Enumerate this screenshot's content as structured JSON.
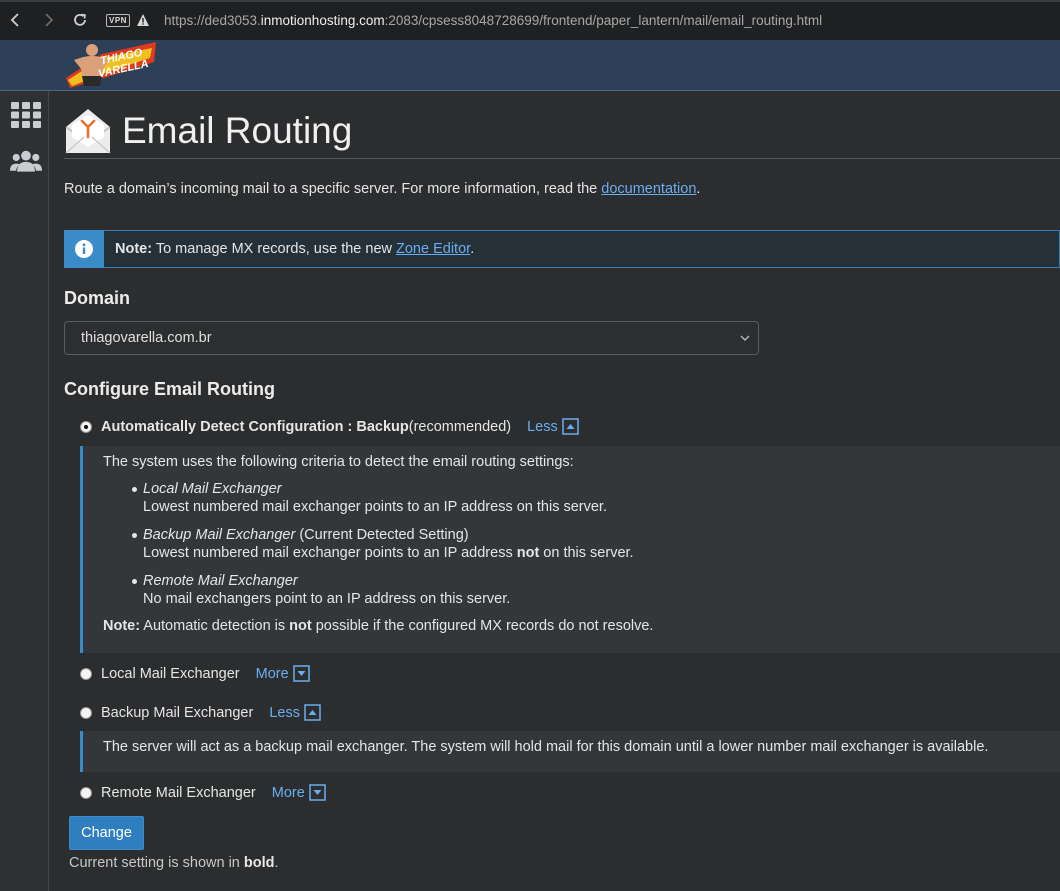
{
  "browser": {
    "url_prefix": "https://ded3053.",
    "url_host": "inmotionhosting.com",
    "url_rest": ":2083/cpsess8048728699/frontend/paper_lantern/mail/email_routing.html",
    "vpn_label": "VPN",
    "icons": [
      "back-icon",
      "forward-icon",
      "reload-icon",
      "vpn-badge",
      "warning-icon"
    ]
  },
  "header": {
    "logo_line1": "THIAGO",
    "logo_line2": "VARELLA"
  },
  "rail": {
    "icons": [
      "apps-grid-icon",
      "users-icon"
    ]
  },
  "page": {
    "title": "Email Routing",
    "intro_text": "Route a domain’s incoming mail to a specific server. For more information, read the ",
    "intro_link": "documentation",
    "intro_end": ".",
    "note_label": "Note:",
    "note_text": " To manage MX records, use the new ",
    "note_link": "Zone Editor",
    "note_end": "."
  },
  "domain": {
    "label": "Domain",
    "selected": "thiagovarella.com.br"
  },
  "config": {
    "label": "Configure Email Routing",
    "option_auto_bold": "Automatically Detect Configuration : Backup",
    "option_auto_suffix": " (recommended)",
    "option_auto_toggle": "Less",
    "auto_panel": {
      "intro": "The system uses the following criteria to detect the email routing settings:",
      "items": [
        {
          "title": "Local Mail Exchanger",
          "title_suffix": "",
          "desc_a": "Lowest numbered mail exchanger points to an IP address on this server.",
          "desc_bold": "",
          "desc_b": ""
        },
        {
          "title": "Backup Mail Exchanger",
          "title_suffix": " (Current Detected Setting)",
          "desc_a": "Lowest numbered mail exchanger points to an IP address ",
          "desc_bold": "not",
          "desc_b": " on this server."
        },
        {
          "title": "Remote Mail Exchanger",
          "title_suffix": "",
          "desc_a": "No mail exchangers point to an IP address on this server.",
          "desc_bold": "",
          "desc_b": ""
        }
      ],
      "note_label": "Note:",
      "note_a": " Automatic detection is ",
      "note_bold": "not",
      "note_b": " possible if the configured MX records do not resolve."
    },
    "option_local": "Local Mail Exchanger",
    "option_local_toggle": "More",
    "option_backup": "Backup Mail Exchanger",
    "option_backup_toggle": "Less",
    "backup_panel_text": "The server will act as a backup mail exchanger. The system will hold mail for this domain until a lower number mail exchanger is available.",
    "option_remote": "Remote Mail Exchanger",
    "option_remote_toggle": "More",
    "selected_option": "auto"
  },
  "actions": {
    "change_label": "Change",
    "footer_a": "Current setting is shown in ",
    "footer_bold": "bold",
    "footer_end": "."
  },
  "colors": {
    "accent": "#3a8cc8",
    "link": "#6aaef0",
    "header_bg": "#2e4057",
    "page_bg": "#2b2d2f"
  }
}
